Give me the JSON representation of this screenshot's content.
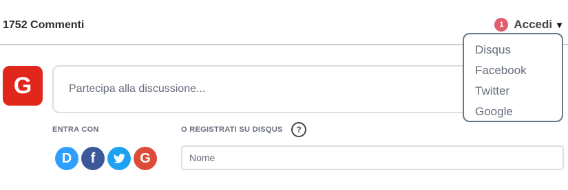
{
  "header": {
    "comment_count": "1752 Commenti",
    "notification_count": "1",
    "login_label": "Accedi"
  },
  "login_menu": {
    "items": [
      "Disqus",
      "Facebook",
      "Twitter",
      "Google"
    ]
  },
  "user": {
    "avatar_letter": "G",
    "avatar_color": "#e1261c"
  },
  "editor": {
    "placeholder": "Partecipa alla discussione..."
  },
  "auth": {
    "enter_with_label": "ENTRA CON",
    "register_label": "O REGISTRATI SU DISQUS",
    "help_symbol": "?",
    "providers": [
      {
        "name": "Disqus",
        "letter": "D",
        "color": "#2e9fff",
        "icon": "disqus-icon"
      },
      {
        "name": "Facebook",
        "letter": "f",
        "color": "#3b5998",
        "icon": "facebook-icon"
      },
      {
        "name": "Twitter",
        "letter": "",
        "color": "#1da1f2",
        "icon": "twitter-icon"
      },
      {
        "name": "Google",
        "letter": "G",
        "color": "#dd4b39",
        "icon": "google-icon"
      }
    ],
    "name_placeholder": "Nome"
  },
  "colors": {
    "notification": "#e05e6d",
    "menu_border": "#687a86"
  }
}
